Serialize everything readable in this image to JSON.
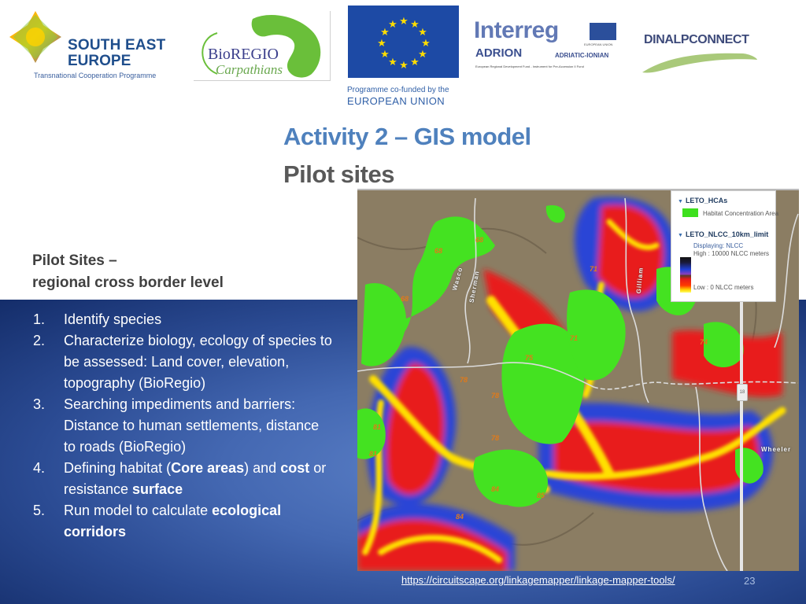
{
  "logos": {
    "see": {
      "line1": "SOUTH EAST",
      "line2": "EUROPE",
      "line3": "Transnational Cooperation Programme"
    },
    "bioregio": {
      "line1": "BioREGIO",
      "line2": "Carpathians"
    },
    "eu": {
      "caption1": "Programme co-funded by the",
      "caption2": "EUROPEAN UNION"
    },
    "interreg": {
      "name": "Interreg",
      "eu_label": "EUROPEAN UNION",
      "programme": "ADRION",
      "region": "ADRIATIC-IONIAN",
      "fund": "European Regional Development Fund - Instrument for Pre-Accession II Fund"
    },
    "dinalp": {
      "name": "DINALPCONNECT"
    }
  },
  "header": {
    "title": "Activity 2 – GIS model",
    "subtitle": "Pilot sites"
  },
  "section": {
    "heading_line1": "Pilot Sites –",
    "heading_line2": "regional cross border level"
  },
  "steps": [
    {
      "num": "1.",
      "parts": [
        {
          "t": "Identify species",
          "b": false
        }
      ]
    },
    {
      "num": "2.",
      "parts": [
        {
          "t": "Characterize biology, ecology of species to be assessed: Land cover, elevation, topography (BioRegio)",
          "b": false
        }
      ]
    },
    {
      "num": "3.",
      "parts": [
        {
          "t": "Searching impediments and barriers: Distance to human settlements, distance to roads (BioRegio)",
          "b": false
        }
      ]
    },
    {
      "num": "4.",
      "parts": [
        {
          "t": "Defining habitat (",
          "b": false
        },
        {
          "t": "Core areas",
          "b": true
        },
        {
          "t": ") and ",
          "b": false
        },
        {
          "t": "cost",
          "b": true
        },
        {
          "t": " or resistance ",
          "b": false
        },
        {
          "t": "surface",
          "b": true
        }
      ]
    },
    {
      "num": "5.",
      "parts": [
        {
          "t": "Run model to calculate ",
          "b": false
        },
        {
          "t": "ecological corridors",
          "b": true
        }
      ]
    }
  ],
  "map": {
    "legend": {
      "layer1": "LETO_HCAs",
      "layer1_item": "Habitat Concentration Area",
      "layer1_color": "#3ee01e",
      "layer2": "LETO_NLCC_10km_limit",
      "displaying": "Displaying:  NLCC",
      "high": "High : 10000 NLCC meters",
      "low": "Low : 0 NLCC meters"
    },
    "zoom_handle": "18",
    "county_labels": [
      "Wasco",
      "Sherman",
      "Gilliam",
      "Wheeler"
    ],
    "site_labels": [
      "68",
      "68",
      "68",
      "71",
      "71",
      "74",
      "75",
      "78",
      "78",
      "78",
      "81",
      "81",
      "84",
      "84",
      "85"
    ]
  },
  "footer": {
    "source_link": "https://circuitscape.org/linkagemapper/linkage-mapper-tools/",
    "slide_number": "23"
  }
}
